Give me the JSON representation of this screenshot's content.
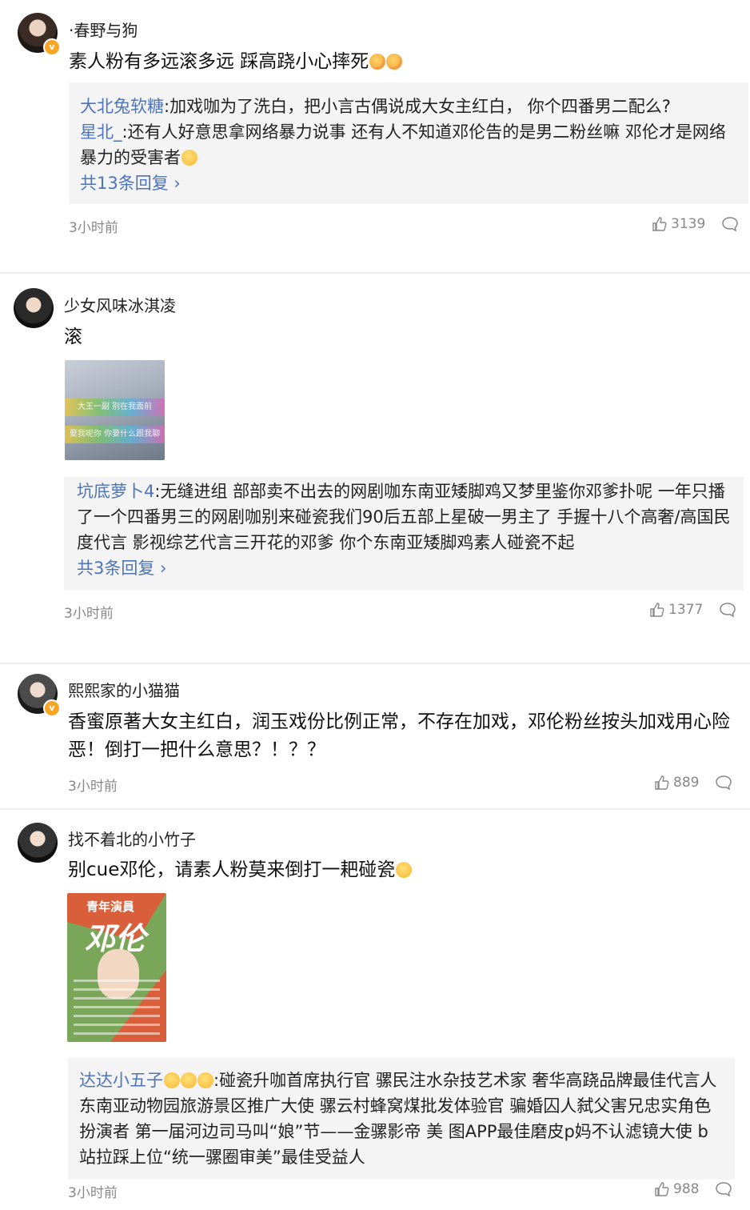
{
  "comments": [
    {
      "user": "·春野与狗",
      "text": "素人粉有多远滚多远 踩高跷小心摔死",
      "replies": [
        {
          "name": "大北兔软糖",
          "text": ":加戏咖为了洗白，把小言古偶说成大女主红白， 你个四番男二配么?"
        },
        {
          "name": "星北_",
          "text": ":还有人好意思拿网络暴力说事 还有人不知道邓伦告的是男二粉丝嘛 邓伦才是网络暴力的受害者"
        }
      ],
      "more": "共13条回复",
      "time": "3小时前",
      "likes": "3139"
    },
    {
      "user": "少女风味冰淇凌",
      "text": "滚",
      "image_caption": [
        "大王一副",
        "别在我面前",
        "要我呢你",
        "你要什么跟我聊"
      ],
      "replies": [
        {
          "name": "坑底萝卜4",
          "text": ":无缝进组 部部卖不出去的网剧咖东南亚矮脚鸡又梦里鉴你邓爹扑呢 一年只播了一个四番男三的网剧咖别来碰瓷我们90后五部上星破一男主了 手握十八个高奢/高国民度代言 影视综艺代言三开花的邓爹 你个东南亚矮脚鸡素人碰瓷不起"
        }
      ],
      "more": "共3条回复",
      "time": "3小时前",
      "likes": "1377"
    },
    {
      "user": "熙熙家的小猫猫",
      "text": "香蜜原著大女主红白，润玉戏份比例正常，不存在加戏，邓伦粉丝按头加戏用心险恶！倒打一把什么意思？！？？",
      "time": "3小时前",
      "likes": "889"
    },
    {
      "user": "找不着北的小竹子",
      "text": "别cue邓伦，请素人粉莫来倒打一耙碰瓷",
      "image_title": "青年演員",
      "image_name": "邓伦",
      "replies": [
        {
          "name": "达达小五子",
          "text": ":碰瓷升咖首席执行官 骡民注水杂技艺术家 奢华高跷品牌最佳代言人 东南亚动物园旅游景区推广大使 骡云村蜂窝煤批发体验官 骗婚囚人弑父害兄忠实角色扮演者 第一届河边司马叫“娘”节——金骡影帝 美 图APP最佳磨皮p妈不认滤镜大使 b站拉踩上位“统一骡圈审美”最佳受益人"
        }
      ],
      "time": "3小时前",
      "likes": "988"
    }
  ],
  "badge_glyph": "v",
  "colors": {
    "link": "#4d74b8",
    "meta": "#888888",
    "reply_bg": "#f4f4f4",
    "badge": "#f6a623"
  },
  "icons": [
    "like-icon",
    "comment-icon",
    "verified-badge-icon",
    "chevron-right-icon",
    "emoji-icon"
  ]
}
